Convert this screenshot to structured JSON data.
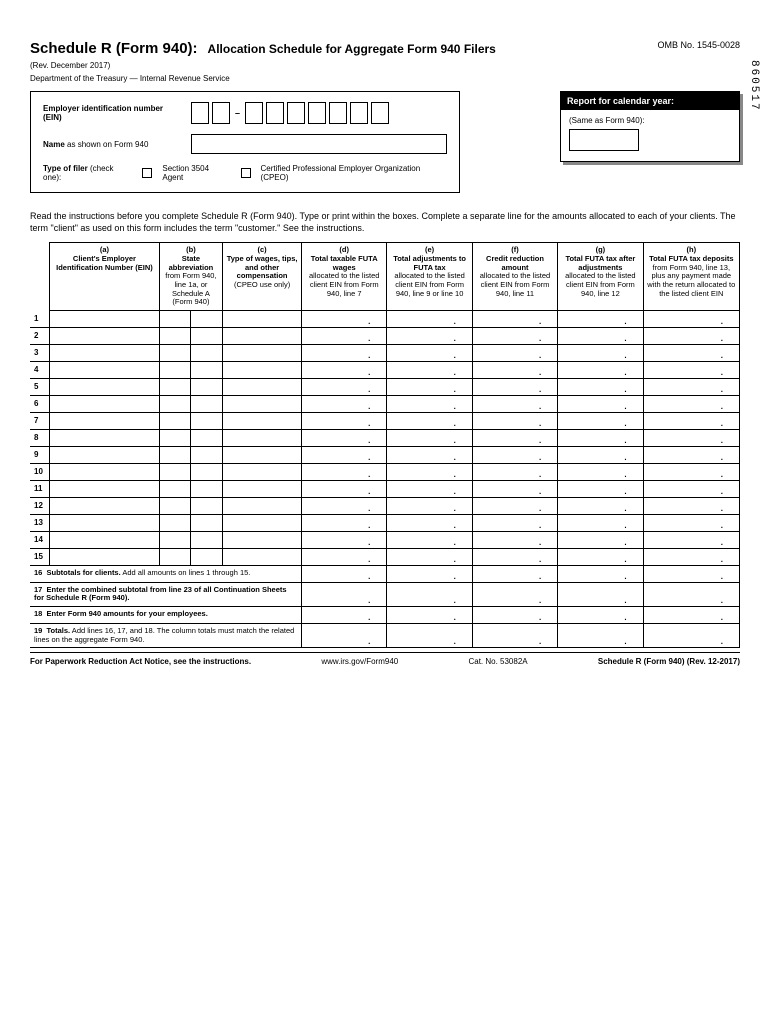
{
  "header": {
    "title": "Schedule R (Form 940):",
    "subtitle": "Allocation Schedule for Aggregate Form 940 Filers",
    "omb": "OMB No. 1545-0028",
    "revision": "(Rev. December 2017)",
    "department": "Department of the Treasury — Internal Revenue Service",
    "side_code": "860517"
  },
  "ein_block": {
    "ein_label": "Employer identification number (EIN)",
    "name_label_bold": "Name",
    "name_label_rest": " as shown on Form 940",
    "filer_label_bold": "Type of filer",
    "filer_label_rest": " (check one):",
    "option1": "Section 3504 Agent",
    "option2": "Certified Professional Employer Organization (CPEO)"
  },
  "report_block": {
    "header": "Report for calendar year:",
    "sub": "(Same as Form 940):"
  },
  "instructions": "Read the instructions before you complete Schedule R (Form 940). Type or print within the boxes. Complete a separate line for the amounts allocated to each of your clients. The term \"client\" as used on this form includes the term \"customer.\" See the instructions.",
  "columns": {
    "a": {
      "letter": "(a)",
      "title": "Client's Employer Identification Number (EIN)"
    },
    "b": {
      "letter": "(b)",
      "title": "State abbreviation",
      "desc": "from Form 940, line 1a, or Schedule A (Form 940)"
    },
    "c": {
      "letter": "(c)",
      "title": "Type of wages, tips, and other compensation",
      "desc": "(CPEO use only)"
    },
    "d": {
      "letter": "(d)",
      "title": "Total taxable FUTA wages",
      "desc": "allocated to the listed client EIN from Form 940, line 7"
    },
    "e": {
      "letter": "(e)",
      "title": "Total adjustments to FUTA tax",
      "desc": "allocated to the listed client EIN from Form 940, line 9 or line 10"
    },
    "f": {
      "letter": "(f)",
      "title": "Credit reduction amount",
      "desc": "allocated to the listed client EIN from Form 940, line 11"
    },
    "g": {
      "letter": "(g)",
      "title": "Total FUTA tax after adjustments",
      "desc": "allocated to the listed client EIN from Form 940, line 12"
    },
    "h": {
      "letter": "(h)",
      "title": "Total FUTA tax deposits",
      "desc": "from Form 940, line 13, plus any payment made with the return allocated to the listed client EIN"
    }
  },
  "rows": [
    "1",
    "2",
    "3",
    "4",
    "5",
    "6",
    "7",
    "8",
    "9",
    "10",
    "11",
    "12",
    "13",
    "14",
    "15"
  ],
  "summary": {
    "r16_num": "16",
    "r16_bold": "Subtotals for clients.",
    "r16_rest": " Add all amounts on lines 1 through 15.",
    "r17_num": "17",
    "r17_bold": "Enter the combined subtotal from line 23 of all Continuation Sheets for Schedule R (Form 940).",
    "r18_num": "18",
    "r18_bold": "Enter Form 940 amounts for your employees.",
    "r19_num": "19",
    "r19_bold": "Totals.",
    "r19_rest": " Add lines 16, 17, and 18. The column totals must match the related lines on the aggregate Form 940."
  },
  "footer": {
    "left": "For Paperwork Reduction Act Notice, see the instructions.",
    "url": "www.irs.gov/Form940",
    "cat": "Cat. No. 53082A",
    "right": "Schedule R (Form 940) (Rev. 12-2017)"
  }
}
